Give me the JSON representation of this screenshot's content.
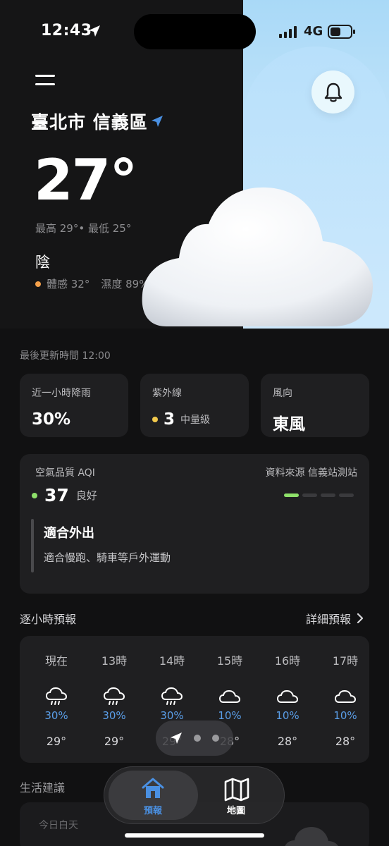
{
  "status_bar": {
    "time": "12:43",
    "network": "4G"
  },
  "location": {
    "city": "臺北市 信義區"
  },
  "current": {
    "temperature": "27°",
    "hilo": "最高 29°• 最低 25°",
    "condition": "陰",
    "feels_like": "體感 32°",
    "humidity": "濕度 89%"
  },
  "updated": "最後更新時間 12:00",
  "cards": {
    "rain": {
      "label": "近一小時降雨",
      "value": "30%"
    },
    "uv": {
      "label": "紫外線",
      "value": "3",
      "level": "中量級"
    },
    "wind": {
      "label": "風向",
      "value": "東風"
    }
  },
  "aqi": {
    "label": "空氣品質 AQI",
    "source": "資料來源 信義站測站",
    "value": "37",
    "level": "良好",
    "advice_title": "適合外出",
    "advice_text": "適合慢跑、騎車等戶外運動"
  },
  "hourly": {
    "title": "逐小時預報",
    "detail_link": "詳細預報",
    "hours": [
      {
        "label": "現在",
        "icon": "rain-cloud-icon",
        "pop": "30%",
        "temp": "29°"
      },
      {
        "label": "13時",
        "icon": "rain-cloud-icon",
        "pop": "30%",
        "temp": "29°"
      },
      {
        "label": "14時",
        "icon": "rain-cloud-icon",
        "pop": "30%",
        "temp": "29°"
      },
      {
        "label": "15時",
        "icon": "cloud-icon",
        "pop": "10%",
        "temp": "28°"
      },
      {
        "label": "16時",
        "icon": "cloud-icon",
        "pop": "10%",
        "temp": "28°"
      },
      {
        "label": "17時",
        "icon": "cloud-icon",
        "pop": "10%",
        "temp": "28°"
      }
    ]
  },
  "life": {
    "title": "生活建議",
    "subtitle": "今日白天"
  },
  "tabs": {
    "forecast": "預報",
    "map": "地圖"
  },
  "colors": {
    "accent_blue": "#4a90e2",
    "aqi_green": "#8ee06a",
    "uv_yellow": "#f2c94c",
    "feels_orange": "#f5a04a"
  }
}
